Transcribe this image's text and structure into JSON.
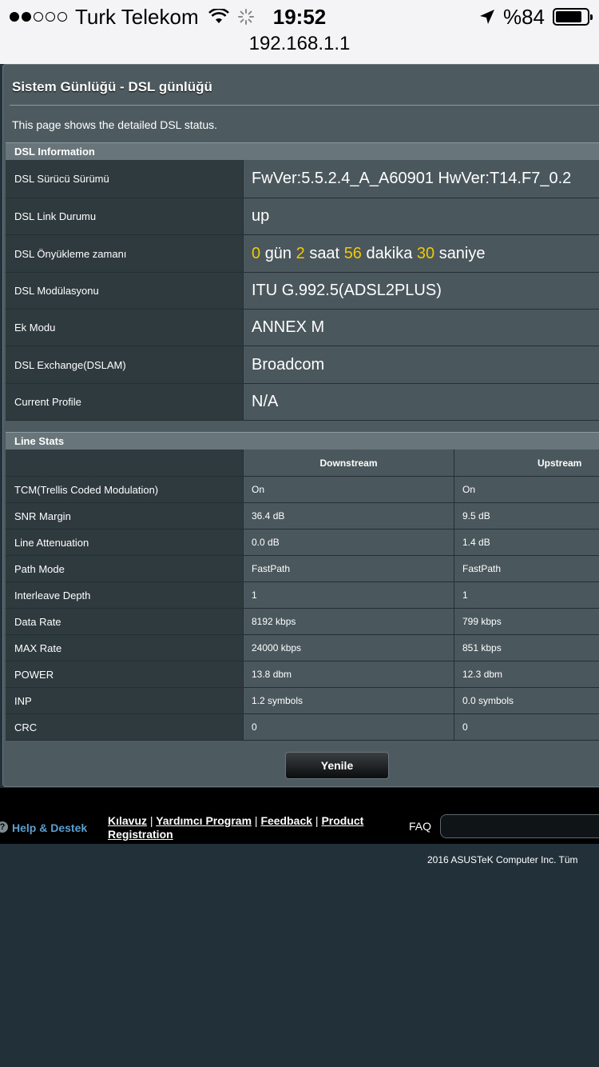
{
  "status_bar": {
    "carrier": "Turk Telekom",
    "time": "19:52",
    "battery": "%84",
    "battery_level": 0.84,
    "signal_bars_filled": 2,
    "signal_bars_total": 5
  },
  "browser": {
    "url": "192.168.1.1"
  },
  "page": {
    "title": "Sistem Günlüğü - DSL günlüğü",
    "description": "This page shows the detailed DSL status."
  },
  "dsl_info": {
    "header": "DSL Information",
    "rows": [
      {
        "label": "DSL Sürücü Sürümü",
        "value": "FwVer:5.5.2.4_A_A60901 HwVer:T14.F7_0.2"
      },
      {
        "label": "DSL Link Durumu",
        "value": "up"
      },
      {
        "label": "DSL Önyükleme zamanı",
        "uptime": {
          "days": "0",
          "days_unit": "gün",
          "hours": "2",
          "hours_unit": "saat",
          "minutes": "56",
          "minutes_unit": "dakika",
          "seconds": "30",
          "seconds_unit": "saniye"
        }
      },
      {
        "label": "DSL Modülasyonu",
        "value": "ITU G.992.5(ADSL2PLUS)"
      },
      {
        "label": "Ek Modu",
        "value": "ANNEX M"
      },
      {
        "label": "DSL Exchange(DSLAM)",
        "value": "Broadcom"
      },
      {
        "label": "Current Profile",
        "value": "N/A"
      }
    ]
  },
  "line_stats": {
    "header": "Line Stats",
    "col_downstream": "Downstream",
    "col_upstream": "Upstream",
    "rows": [
      {
        "label": "TCM(Trellis Coded Modulation)",
        "down": "On",
        "up": "On"
      },
      {
        "label": "SNR Margin",
        "down": "36.4 dB",
        "up": "9.5 dB"
      },
      {
        "label": "Line Attenuation",
        "down": "0.0 dB",
        "up": "1.4 dB"
      },
      {
        "label": "Path Mode",
        "down": "FastPath",
        "up": "FastPath"
      },
      {
        "label": "Interleave Depth",
        "down": "1",
        "up": "1"
      },
      {
        "label": "Data Rate",
        "down": "8192 kbps",
        "up": "799 kbps"
      },
      {
        "label": "MAX Rate",
        "down": "24000 kbps",
        "up": "851 kbps"
      },
      {
        "label": "POWER",
        "down": "13.8 dbm",
        "up": "12.3 dbm"
      },
      {
        "label": "INP",
        "down": "1.2 symbols",
        "up": "0.0 symbols"
      },
      {
        "label": "CRC",
        "down": "0",
        "up": "0"
      }
    ]
  },
  "refresh_button": "Yenile",
  "footer": {
    "help_label": "Help & Destek",
    "links": [
      "Kılavuz",
      "Yardımcı Program",
      "Feedback",
      "Product Registration"
    ],
    "faq_label": "FAQ",
    "copyright": "2016 ASUSTeK Computer Inc. Tüm"
  },
  "colors": {
    "accent_yellow": "#f2c800",
    "help_blue": "#5a9fd0",
    "panel_bg": "#4d5a60",
    "label_bg": "#2f3a3f"
  }
}
